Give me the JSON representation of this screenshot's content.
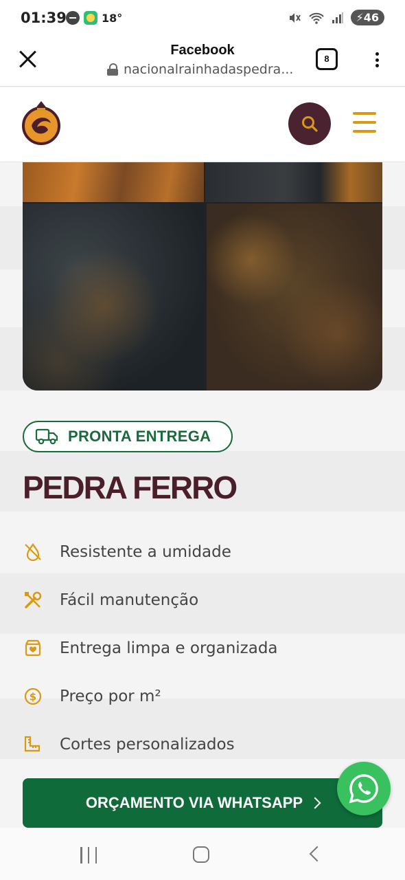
{
  "status_bar": {
    "time": "01:39",
    "temperature": "18°",
    "battery": "46",
    "icons": [
      "do-not-disturb-icon",
      "weather-icon",
      "mute-icon",
      "wifi-icon",
      "signal-icon",
      "battery-icon"
    ]
  },
  "browser": {
    "title": "Facebook",
    "url": "nacionalrainhadaspedra...",
    "tab_count": "8",
    "icons": [
      "close-icon",
      "lock-icon",
      "more-vert-icon"
    ]
  },
  "header": {
    "icons": [
      "logo",
      "search-icon",
      "menu-icon"
    ],
    "colors": {
      "search_bg": "#4a2230",
      "menu": "#d89a12"
    }
  },
  "product": {
    "badge": "PRONTA ENTREGA",
    "title": "PEDRA FERRO",
    "features": [
      {
        "icon": "no-water-icon",
        "label": "Resistente a umidade"
      },
      {
        "icon": "tools-icon",
        "label": "Fácil manutenção"
      },
      {
        "icon": "box-heart-icon",
        "label": "Entrega limpa e organizada"
      },
      {
        "icon": "dollar-coin-icon",
        "label": "Preço por m²"
      },
      {
        "icon": "ruler-icon",
        "label": "Cortes personalizados"
      }
    ],
    "cta_label": "ORÇAMENTO VIA WHATSAPP",
    "colors": {
      "green": "#0f6b3a",
      "title": "#4a1f2a",
      "icon": "#d89a12"
    }
  },
  "fab": {
    "icon": "whatsapp-icon"
  },
  "nav_bar": {
    "icons": [
      "recent-apps-icon",
      "home-icon",
      "back-icon"
    ]
  }
}
